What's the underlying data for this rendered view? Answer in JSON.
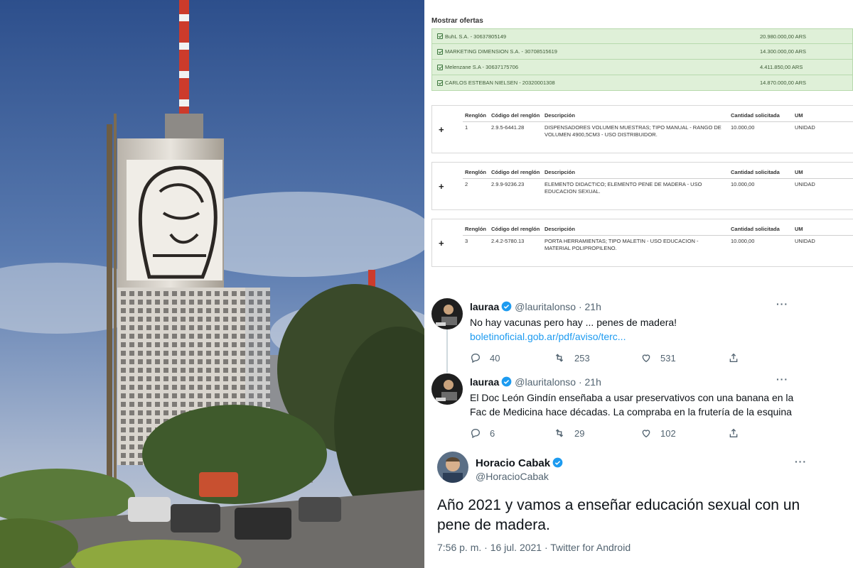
{
  "offers": {
    "title": "Mostrar ofertas",
    "rows": [
      {
        "name": "BuhL S.A. - 30637805149",
        "amount": "20.980.000,00 ARS"
      },
      {
        "name": "MARKETING DIMENSION S.A. - 30708515619",
        "amount": "14.300.000,00 ARS"
      },
      {
        "name": "Melenzane S.A - 30637175706",
        "amount": "4.411.850,00 ARS"
      },
      {
        "name": "CARLOS ESTEBAN NIELSEN - 20320001308",
        "amount": "14.870.000,00 ARS"
      }
    ]
  },
  "items": {
    "headers": {
      "renglon": "Renglón",
      "codigo": "Código del renglón",
      "descripcion": "Descripción",
      "cantidad": "Cantidad solicitada",
      "um": "UM"
    },
    "expand_symbol": "+",
    "rows": [
      {
        "renglon": "1",
        "codigo": "2.9.5-6441.28",
        "descripcion": "DISPENSADORES VOLUMEN MUESTRAS; TIPO MANUAL - RANGO DE VOLUMEN 4900,5CM3 - USO DISTRIBUIDOR.",
        "cantidad": "10.000,00",
        "um": "UNIDAD"
      },
      {
        "renglon": "2",
        "codigo": "2.9.9-9236.23",
        "descripcion": "ELEMENTO DIDACTICO; ELEMENTO PENE DE MADERA - USO EDUCACION SEXUAL.",
        "cantidad": "10.000,00",
        "um": "UNIDAD"
      },
      {
        "renglon": "3",
        "codigo": "2.4.2-5780.13",
        "descripcion": "PORTA HERRAMIENTAS; TIPO MALETIN - USO EDUCACION - MATERIAL POLIPROPILENO.",
        "cantidad": "10.000,00",
        "um": "UNIDAD"
      }
    ]
  },
  "tweets": [
    {
      "name": "lauraa",
      "handle": "@lauritalonso",
      "sep": "·",
      "time": "21h",
      "text": "No hay vacunas pero hay ... penes de madera!",
      "link": "boletinoficial.gob.ar/pdf/aviso/terc...",
      "replies": "40",
      "retweets": "253",
      "likes": "531"
    },
    {
      "name": "lauraa",
      "handle": "@lauritalonso",
      "sep": "·",
      "time": "21h",
      "text": "El Doc León Gindín enseñaba a usar preservativos con una banana en la Fac de Medicina hace décadas. La compraba en la frutería de la esquina",
      "replies": "6",
      "retweets": "29",
      "likes": "102"
    }
  ],
  "main_tweet": {
    "name": "Horacio Cabak",
    "handle": "@HoracioCabak",
    "text": "Año 2021 y vamos a enseñar educación sexual con un pene de madera.",
    "meta": "7:56 p. m. · 16 jul. 2021 · Twitter for Android"
  },
  "more_symbol": "···",
  "colors": {
    "accent": "#1d9bf0",
    "offer_bg": "#dff0d8",
    "text": "#0f1419",
    "muted": "#536471"
  }
}
